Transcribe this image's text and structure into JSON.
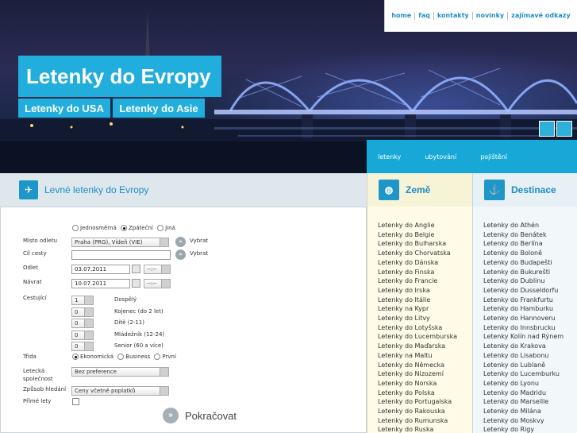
{
  "topnav": {
    "items": [
      "home",
      "faq",
      "kontakty",
      "novinky",
      "zajímavé odkazy"
    ]
  },
  "brand": {
    "title": "Letenky do Evropy",
    "usa": "Letenky do USA",
    "asia": "Letenky do Asie"
  },
  "subnav": {
    "items": [
      "letenky",
      "ubytování",
      "pojištění"
    ]
  },
  "section": {
    "title": "Levné letenky do Evropy"
  },
  "zeme": {
    "title": "Země",
    "items": [
      "Letenky do Anglie",
      "Letenky do Belgie",
      "Letenky do Bulharska",
      "Letenky do Chorvatska",
      "Letenky do Dánska",
      "Letenky do Finska",
      "Letenky do Francie",
      "Letenky do Irska",
      "Letenky do Itálie",
      "Letenky na Kypr",
      "Letenky do Litvy",
      "Letenky do Lotyšska",
      "Letenky do Lucemburska",
      "Letenky do Maďarska",
      "Letenky na Maltu",
      "Letenky do Německa",
      "Letenky do Nizozemí",
      "Letenky do Norska",
      "Letenky do Polska",
      "Letenky do Portugalska",
      "Letenky do Rakouska",
      "Letenky do Rumunska",
      "Letenky do Ruska"
    ]
  },
  "destinace": {
    "title": "Destinace",
    "items": [
      "Letenky do Athén",
      "Letenky do Benátek",
      "Letenky do Berlína",
      "Letenky do Boloně",
      "Letenky do Budapešti",
      "Letenky do Bukurešti",
      "Letenky do Dublinu",
      "Letenky do Dusseldorfu",
      "Letenky do Frankfurtu",
      "Letenky do Hamburku",
      "Letenky do Hannoveru",
      "Letenky do Innsbrucku",
      "Letenky Kolín nad Rýnem",
      "Letenky do Krakova",
      "Letenky do Lisabonu",
      "Letenky do Lublaně",
      "Letenky do Lucemburku",
      "Letenky do Lyonu",
      "Letenky do Madridu",
      "Letenky do Marseille",
      "Letenky do Milána",
      "Letenky do Moskvy",
      "Letenky do Rigy"
    ]
  },
  "form": {
    "trip_types": [
      "Jednosměrná",
      "Zpáteční",
      "Jiná"
    ],
    "trip_selected": "Zpáteční",
    "from_label": "Místo odletu",
    "from_value": "Praha (PRG), Vídeň (VIE)",
    "choose1": "Vybrat",
    "to_label": "Cíl cesty",
    "to_value": "",
    "choose2": "Vybrat",
    "depart_label": "Odlet",
    "depart_date": "03.07.2011",
    "depart_time": "--:--",
    "return_label": "Návrat",
    "return_date": "10.07.2011",
    "return_time": "--:--",
    "travellers_label": "Cestující",
    "pax": [
      {
        "count": "1",
        "label": "Dospělý"
      },
      {
        "count": "0",
        "label": "Kojenec (do 2 let)"
      },
      {
        "count": "0",
        "label": "Dítě (2-11)"
      },
      {
        "count": "0",
        "label": "Mládežník (12-24)"
      },
      {
        "count": "0",
        "label": "Senior (60 a více)"
      }
    ],
    "class_label": "Třída",
    "classes": [
      "Ekonomická",
      "Business",
      "První"
    ],
    "class_selected": "Ekonomická",
    "airline_label_1": "Letecká",
    "airline_label_2": "společnost",
    "airline_value": "Bez preference",
    "search_label": "Způsob hledání",
    "search_value": "Ceny včetně poplatků",
    "direct_label": "Přímé lety",
    "continue": "Pokračovat"
  },
  "colors": {
    "accent": "#22aedd",
    "link": "#1e8cc8"
  }
}
